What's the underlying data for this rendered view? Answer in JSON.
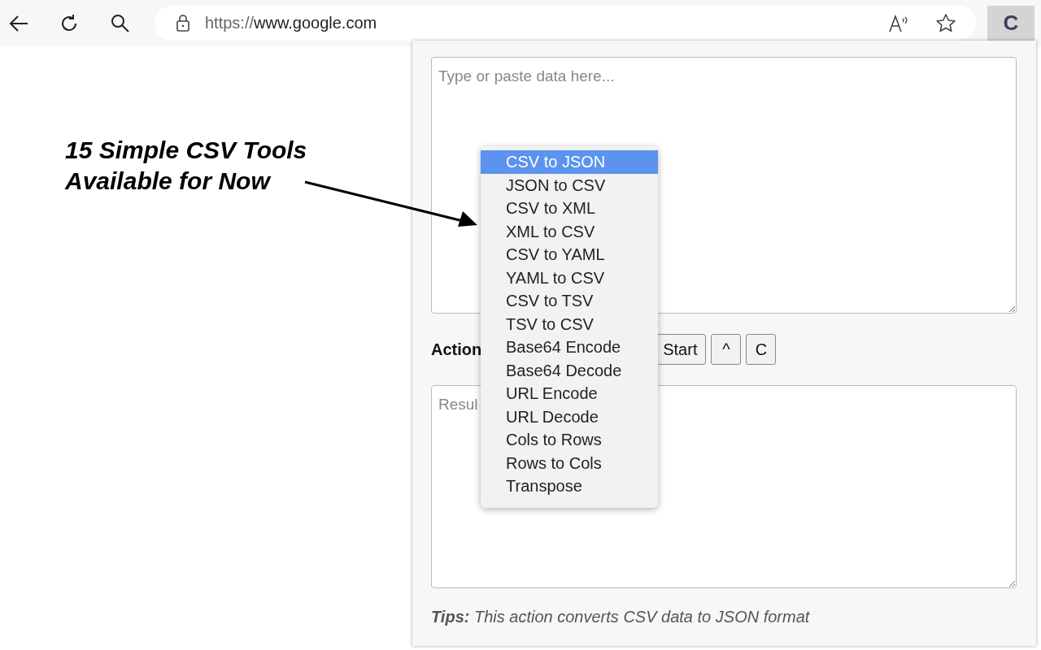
{
  "toolbar": {
    "url_scheme": "https://",
    "url_host": "www.google.com",
    "extension_label": "C"
  },
  "annotation": {
    "lines": [
      "15 Simple CSV Tools",
      "Available for Now"
    ]
  },
  "popup": {
    "input": {
      "placeholder": "Type or paste data here..."
    },
    "actions_label": "Action",
    "buttons": [
      {
        "label": "Start"
      },
      {
        "label": "^"
      },
      {
        "label": "C"
      }
    ],
    "output": {
      "placeholder": "Resul"
    },
    "tips": "**Tips:** This action converts CSV data to JSON format",
    "dropdown": [
      {
        "label": "CSV to JSON",
        "selected": true
      },
      {
        "label": "JSON to CSV",
        "selected": false
      },
      {
        "label": "CSV to XML",
        "selected": false
      },
      {
        "label": "XML to CSV",
        "selected": false
      },
      {
        "label": "CSV to YAML",
        "selected": false
      },
      {
        "label": "YAML to CSV",
        "selected": false
      },
      {
        "label": "CSV to TSV",
        "selected": false
      },
      {
        "label": "TSV to CSV",
        "selected": false
      },
      {
        "label": "Base64 Encode",
        "selected": false
      },
      {
        "label": "Base64 Decode",
        "selected": false
      },
      {
        "label": "URL Encode",
        "selected": false
      },
      {
        "label": "URL Decode",
        "selected": false
      },
      {
        "label": "Cols to Rows",
        "selected": false
      },
      {
        "label": "Rows to Cols",
        "selected": false
      },
      {
        "label": "Transpose",
        "selected": false
      }
    ]
  }
}
